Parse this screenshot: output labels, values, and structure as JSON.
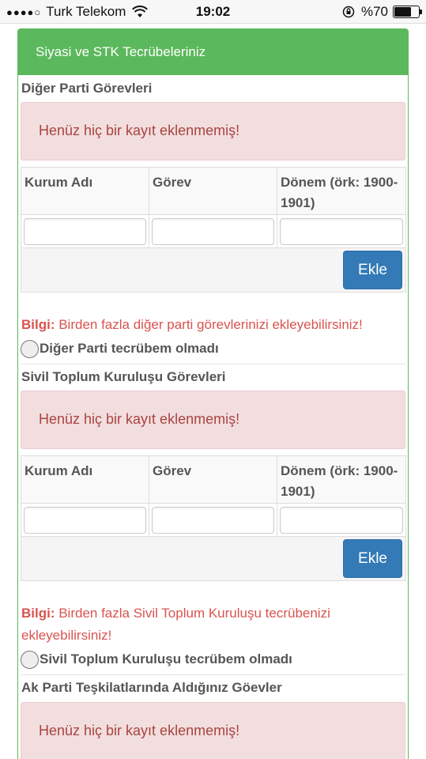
{
  "status_bar": {
    "signal": "●●●●○",
    "carrier": "Turk Telekom",
    "time": "19:02",
    "battery_text": "%70",
    "battery_level": 0.7
  },
  "panel": {
    "title": "Siyasi ve STK Tecrübeleriniz"
  },
  "sections": [
    {
      "title": "Diğer Parti Görevleri",
      "empty_message": "Henüz hiç bir kayıt eklenmemiş!",
      "columns": [
        "Kurum Adı",
        "Görev",
        "Dönem (örk: 1900-1901)"
      ],
      "add_button": "Ekle",
      "info_label": "Bilgi:",
      "info_text": " Birden fazla diğer parti görevlerinizi ekleyebilirsiniz!",
      "checkbox_label": "Diğer Parti tecrübem olmadı"
    },
    {
      "title": "Sivil Toplum Kuruluşu Görevleri",
      "empty_message": "Henüz hiç bir kayıt eklenmemiş!",
      "columns": [
        "Kurum Adı",
        "Görev",
        "Dönem (örk: 1900-1901)"
      ],
      "add_button": "Ekle",
      "info_label": "Bilgi:",
      "info_text": " Birden fazla Sivil Toplum Kuruluşu tecrübenizi ekleyebilirsiniz!",
      "checkbox_label": "Sivil Toplum Kuruluşu tecrübem olmadı"
    },
    {
      "title": "Ak Parti Teşkilatlarında Aldığınız Göevler",
      "empty_message": "Henüz hiç bir kayıt eklenmemiş!"
    }
  ],
  "colors": {
    "panel_green": "#5cb85c",
    "alert_bg": "#f2dede",
    "alert_text": "#a94442",
    "info_red": "#d9534f",
    "button_blue": "#337ab7"
  }
}
